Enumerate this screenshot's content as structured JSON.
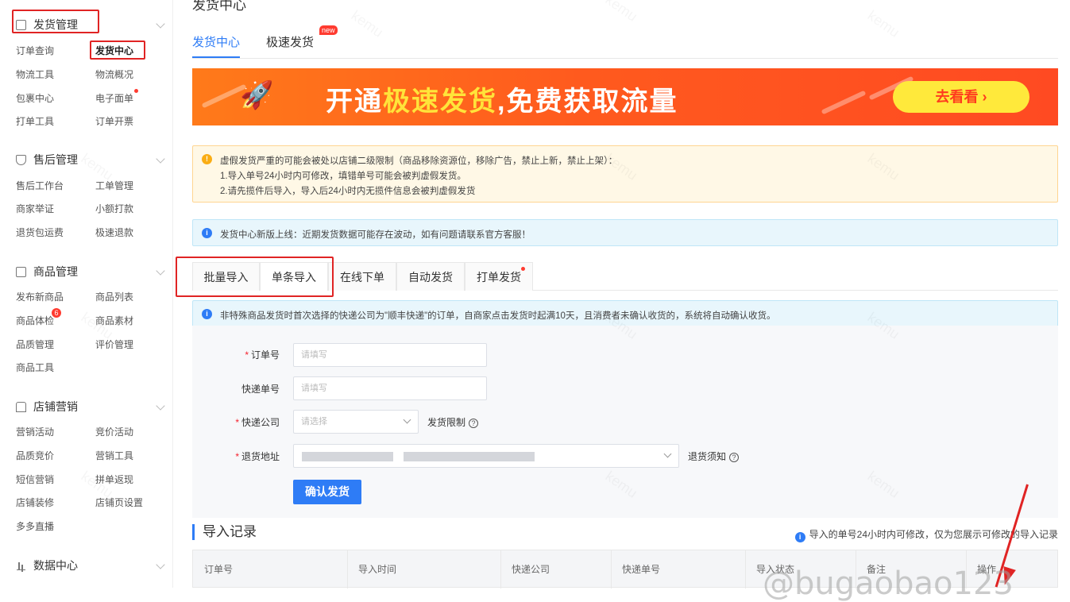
{
  "sidebar": {
    "groups": [
      {
        "title": "发货管理",
        "items": [
          "订单查询",
          "发货中心",
          "物流工具",
          "物流概况",
          "包裹中心",
          "电子面单",
          "打单工具",
          "订单开票"
        ]
      },
      {
        "title": "售后管理",
        "items": [
          "售后工作台",
          "工单管理",
          "商家举证",
          "小额打款",
          "退货包运费",
          "极速退款"
        ]
      },
      {
        "title": "商品管理",
        "items": [
          "发布新商品",
          "商品列表",
          "商品体检",
          "商品素材",
          "品质管理",
          "评价管理",
          "商品工具"
        ]
      },
      {
        "title": "店铺营销",
        "items": [
          "营销活动",
          "竞价活动",
          "品质竞价",
          "营销工具",
          "短信营销",
          "拼单返现",
          "店铺装修",
          "店铺页设置",
          "多多直播"
        ]
      },
      {
        "title": "数据中心",
        "items": []
      }
    ],
    "badge_count": "6"
  },
  "page": {
    "title": "发货中心",
    "tabs": [
      "发货中心",
      "极速发货"
    ],
    "new_tag": "new"
  },
  "banner": {
    "text_a": "开通",
    "text_b": "极速发货",
    "text_c": ",免费获取流量",
    "button": "去看看 ›"
  },
  "warning": {
    "line1": "虚假发货严重的可能会被处以店铺二级限制（商品移除资源位，移除广告，禁止上新，禁止上架）：",
    "line2": "1.导入单号24小时内可修改，填错单号可能会被判虚假发货。",
    "line3": "2.请先揽件后导入，导入后24小时内无揽件信息会被判虚假发货"
  },
  "notice1": "发货中心新版上线：近期发货数据可能存在波动，如有问题请联系官方客服！",
  "sub_tabs": [
    "批量导入",
    "单条导入",
    "在线下单",
    "自动发货",
    "打单发货"
  ],
  "notice2": "非特殊商品发货时首次选择的快递公司为\"顺丰快递\"的订单，自商家点击发货时起满10天，且消费者未确认收货的，系统将自动确认收货。",
  "form": {
    "order_label": "订单号",
    "order_placeholder": "请填写",
    "tracking_label": "快递单号",
    "tracking_placeholder": "请填写",
    "company_label": "快递公司",
    "company_placeholder": "请选择",
    "limit_link": "发货限制",
    "address_label": "退货地址",
    "address_note": "退货须知",
    "confirm": "确认发货"
  },
  "records": {
    "title": "导入记录",
    "note": "导入的单号24小时内可修改，仅为您展示可修改的导入记录",
    "columns": [
      "订单号",
      "导入时间",
      "快递公司",
      "快递单号",
      "导入状态",
      "备注",
      "操作"
    ]
  },
  "watermark": "kemu",
  "footer_watermark": "@bugaobao123",
  "colors": {
    "primary": "#2e7cf6",
    "annotation": "#e02424",
    "banner": "#ff5a1e"
  }
}
